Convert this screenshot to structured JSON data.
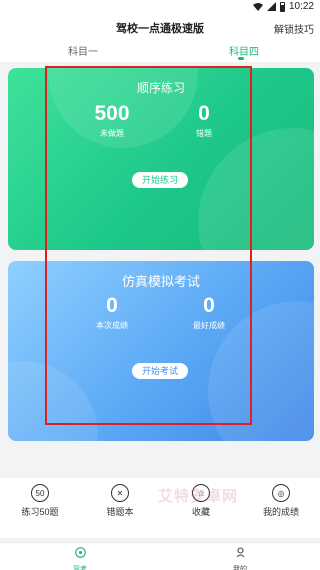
{
  "status_bar": {
    "time": "10:22"
  },
  "header": {
    "title": "驾校一点通极速版",
    "unlock_tips": "解锁技巧",
    "tabs": [
      {
        "label": "科目一",
        "active": false
      },
      {
        "label": "科目四",
        "active": true
      }
    ],
    "accent_color": "#20b777"
  },
  "practice_card": {
    "title": "顺序练习",
    "stats": [
      {
        "value": "500",
        "label": "未做题"
      },
      {
        "value": "0",
        "label": "错题"
      }
    ],
    "button": "开始练习",
    "color": "#1ec88a"
  },
  "exam_card": {
    "title": "仿真模拟考试",
    "stats": [
      {
        "value": "0",
        "label": "本次成绩"
      },
      {
        "value": "0",
        "label": "最好成绩"
      }
    ],
    "button": "开始考试",
    "color": "#4a94ee"
  },
  "quick_actions": [
    {
      "label": "练习50题",
      "icon": "fifty-badge-icon",
      "glyph": "50"
    },
    {
      "label": "错题本",
      "icon": "x-circle-icon",
      "glyph": "✕"
    },
    {
      "label": "收藏",
      "icon": "star-circle-icon",
      "glyph": "☆"
    },
    {
      "label": "我的成绩",
      "icon": "medal-icon",
      "glyph": "◎"
    }
  ],
  "bottom_nav": [
    {
      "label": "驾考",
      "icon": "driving-icon",
      "active": true
    },
    {
      "label": "我的",
      "icon": "profile-icon",
      "active": false
    }
  ],
  "watermark": "艾特安卓网",
  "highlight_color": "#e02020"
}
